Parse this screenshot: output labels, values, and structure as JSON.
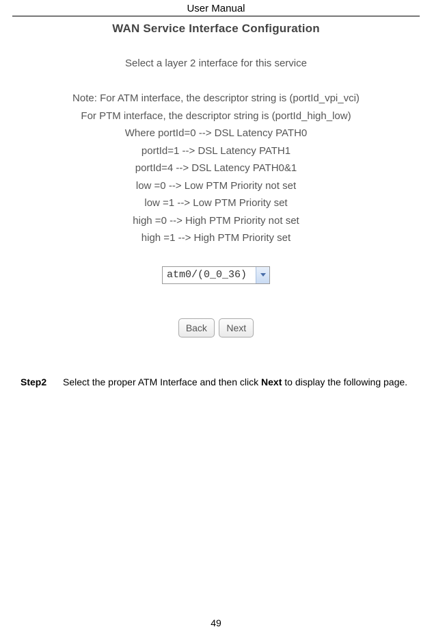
{
  "header": {
    "title": "User Manual"
  },
  "config": {
    "title": "WAN Service Interface Configuration",
    "intro": "Select a layer 2 interface for this service",
    "notes": [
      "Note: For ATM interface, the descriptor string is (portId_vpi_vci)",
      "For PTM interface, the descriptor string is (portId_high_low)",
      "Where portId=0 --> DSL Latency PATH0",
      "portId=1 --> DSL Latency PATH1",
      "portId=4 --> DSL Latency PATH0&1",
      "low =0 --> Low PTM Priority not set",
      "low =1 --> Low PTM Priority set",
      "high =0 --> High PTM Priority not set",
      "high =1 --> High PTM Priority set"
    ],
    "dropdown_value": "atm0/(0_0_36) ",
    "back_label": "Back",
    "next_label": "Next"
  },
  "step": {
    "label": "Step2",
    "before": "Select the proper ATM Interface and then click ",
    "bold": "Next",
    "after": " to display the following page."
  },
  "page_number": "49"
}
